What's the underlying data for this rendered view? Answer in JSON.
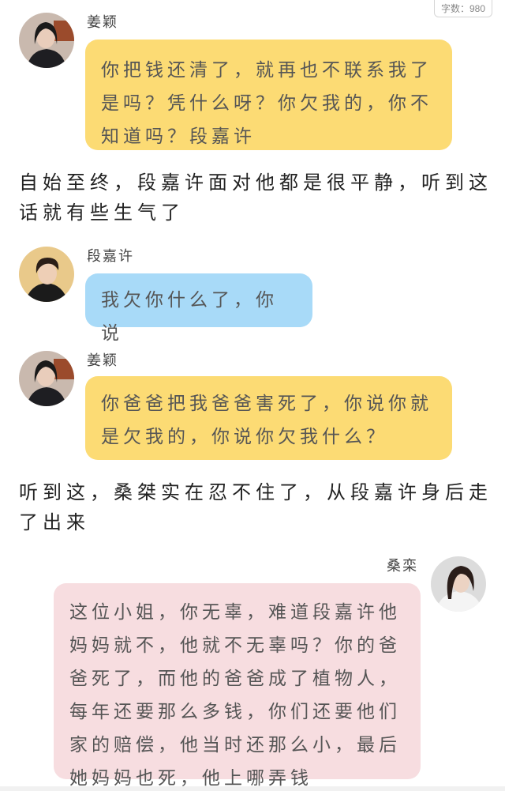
{
  "word_count": "字数：980",
  "messages": [
    {
      "speaker": "姜颖",
      "text": "你把钱还清了，就再也不联系我了是吗？凭什么呀？你欠我的，你不知道吗？段嘉许"
    },
    {
      "narration": "自始至终，段嘉许面对他都是很平静，听到这话就有些生气了"
    },
    {
      "speaker": "段嘉许",
      "text": "我欠你什么了，你说"
    },
    {
      "speaker": "姜颖",
      "text": "你爸爸把我爸爸害死了，你说你就是欠我的，你说你欠我什么？"
    },
    {
      "narration": "听到这，桑桀实在忍不住了，从段嘉许身后走了出来"
    },
    {
      "speaker": "桑栾",
      "text": "这位小姐，你无辜，难道段嘉许他妈妈就不，他就不无辜吗？你的爸爸死了，而他的爸爸成了植物人，每年还要那么多钱，你们还要他们家的赔偿，他当时还那么小，最后她妈妈也死，他上哪弄钱"
    }
  ],
  "colors": {
    "yellow": "#fcdb74",
    "blue": "#a8daf8",
    "pink": "#f7dde0"
  }
}
